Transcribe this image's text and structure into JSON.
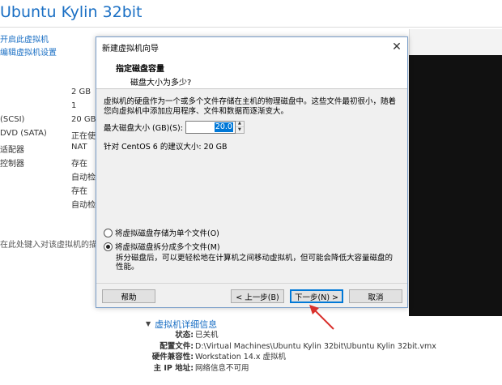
{
  "window": {
    "title": "Ubuntu Kylin 32bit"
  },
  "sidebar_links": [
    "开启此虚拟机",
    "编辑虚拟机设置"
  ],
  "devices": [
    {
      "name": "",
      "value": "2 GB"
    },
    {
      "name": "",
      "value": "1"
    },
    {
      "name": "(SCSI)",
      "value": "20 GB"
    },
    {
      "name": "DVD (SATA)",
      "value": "正在使用"
    },
    {
      "name": "适配器",
      "value": "NAT"
    },
    {
      "name": "控制器",
      "value": "存在"
    },
    {
      "name": "",
      "value": "自动检测"
    },
    {
      "name": "",
      "value": "存在"
    },
    {
      "name": "",
      "value": "自动检测"
    }
  ],
  "description_hint": "在此处键入对该虚拟机的描述。",
  "details": {
    "heading": "虚拟机详细信息",
    "rows": [
      {
        "key": "状态:",
        "value": "已关机"
      },
      {
        "key": "配置文件:",
        "value": "D:\\Virtual Machines\\Ubuntu Kylin 32bit\\Ubuntu Kylin 32bit.vmx"
      },
      {
        "key": "硬件兼容性:",
        "value": "Workstation 14.x 虚拟机"
      },
      {
        "key": "主 IP 地址:",
        "value": "网络信息不可用"
      }
    ]
  },
  "dialog": {
    "title": "新建虚拟机向导",
    "heading": "指定磁盘容量",
    "subheading": "磁盘大小为多少?",
    "description": "虚拟机的硬盘作为一个或多个文件存储在主机的物理磁盘中。这些文件最初很小，随着您向虚拟机中添加应用程序、文件和数据而逐渐变大。",
    "size_label": "最大磁盘大小 (GB)(S):",
    "size_value": "20.0",
    "recommended": "针对 CentOS 6 的建议大小: 20 GB",
    "option_single": "将虚拟磁盘存储为单个文件(O)",
    "option_multi": "将虚拟磁盘拆分成多个文件(M)",
    "option_multi_note": "拆分磁盘后，可以更轻松地在计算机之间移动虚拟机，但可能会降低大容量磁盘的性能。",
    "selected_option": "multi",
    "buttons": {
      "help": "帮助",
      "back": "< 上一步(B)",
      "next": "下一步(N) >",
      "cancel": "取消"
    }
  },
  "colors": {
    "accent": "#1a6fc4",
    "selection": "#0078d7",
    "arrow": "#d9302c"
  }
}
